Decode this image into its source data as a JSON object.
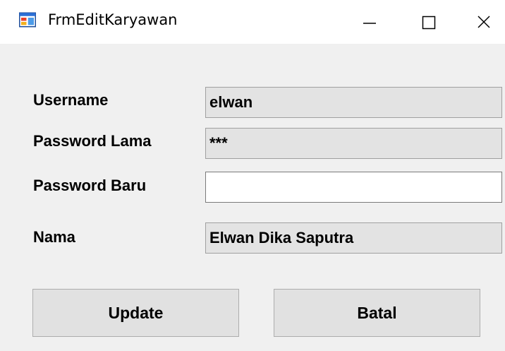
{
  "window": {
    "title": "FrmEditKaryawan",
    "icon": "windows-form-icon",
    "controls": {
      "minimize": "minimize-icon",
      "maximize": "maximize-icon",
      "close": "close-icon"
    }
  },
  "form": {
    "username_label": "Username",
    "username_value": "elwan",
    "old_password_label": "Password Lama",
    "old_password_value": "***",
    "new_password_label": "Password Baru",
    "new_password_value": "",
    "name_label": "Nama",
    "name_value": "Elwan Dika Saputra"
  },
  "buttons": {
    "update": "Update",
    "cancel": "Batal"
  }
}
